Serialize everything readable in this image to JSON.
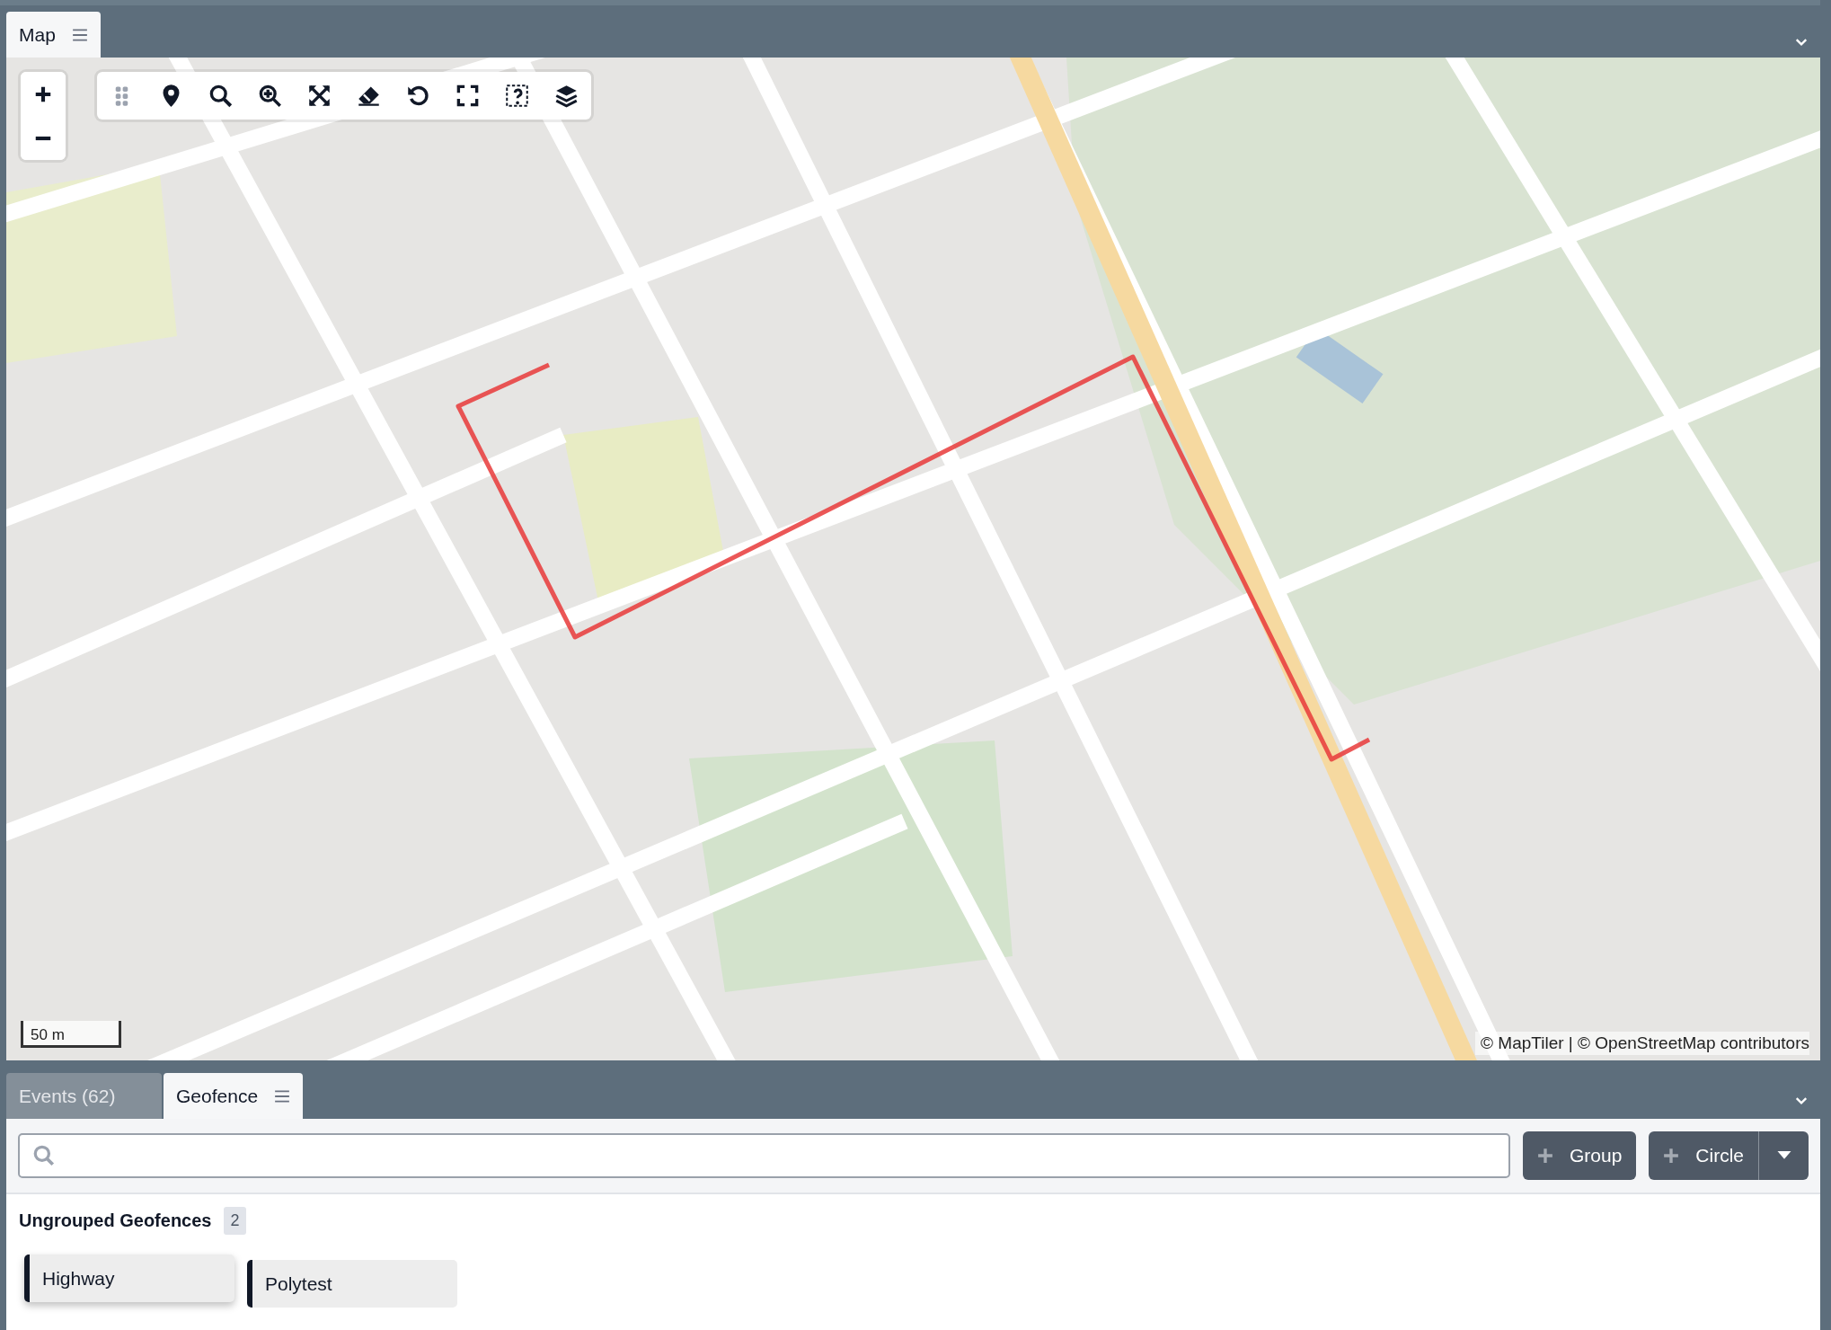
{
  "map_panel": {
    "tabs": [
      {
        "label": "Map",
        "selected": true
      }
    ],
    "scale": "50 m",
    "attribution": "© MapTiler | © OpenStreetMap contributors",
    "toolbar": [
      {
        "kind": "drag"
      },
      {
        "kind": "marker"
      },
      {
        "kind": "search"
      },
      {
        "kind": "zoom-in"
      },
      {
        "kind": "fit"
      },
      {
        "kind": "erase"
      },
      {
        "kind": "undo"
      },
      {
        "kind": "fullscreen"
      },
      {
        "kind": "identify"
      },
      {
        "kind": "layers"
      }
    ]
  },
  "bottom_panel": {
    "tabs": [
      {
        "label": "Events (62)",
        "selected": false
      },
      {
        "label": "Geofence",
        "selected": true
      }
    ],
    "buttons": [
      {
        "label": "Group",
        "kind": "add"
      },
      {
        "label": "Circle",
        "kind": "split"
      }
    ],
    "section": {
      "title": "Ungrouped Geofences",
      "count": "2"
    },
    "geofences": [
      {
        "name": "Highway",
        "selected": true
      },
      {
        "name": "Polytest",
        "selected": false
      }
    ]
  }
}
